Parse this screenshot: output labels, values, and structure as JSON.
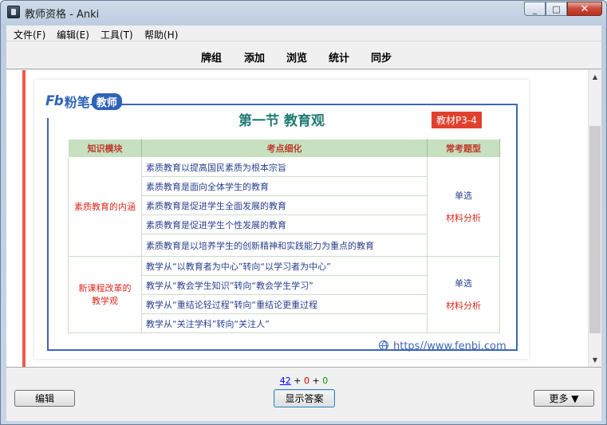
{
  "window": {
    "title": "教师资格 - Anki",
    "controls": {
      "minimize": "▭",
      "maximize": "□",
      "close": "✕"
    }
  },
  "menu": [
    "文件(F)",
    "编辑(E)",
    "工具(T)",
    "帮助(H)"
  ],
  "toolbar": {
    "decks": "牌组",
    "add": "添加",
    "browse": "浏览",
    "stats": "统计",
    "sync": "同步"
  },
  "card": {
    "logo": {
      "fb": "Fb",
      "brand": "粉笔",
      "badge": "教师"
    },
    "section_title": "第一节 教育观",
    "book_ref": "教材P3-4",
    "table": {
      "headers": [
        "知识模块",
        "考点细化",
        "常考题型"
      ],
      "groups": [
        {
          "module": "素质教育的内涵",
          "points": [
            "素质教育以提高国民素质为根本宗旨",
            "素质教育是面向全体学生的教育",
            "素质教育是促进学生全面发展的教育",
            "素质教育是促进学生个性发展的教育",
            "素质教育是以培养学生的创新精神和实践能力为重点的教育"
          ],
          "qtypes": [
            "单选",
            "材料分析"
          ]
        },
        {
          "module_line1": "新课程改革的",
          "module_line2": "教学观",
          "points": [
            "教学从“以教育者为中心”转向“以学习者为中心”",
            "教学从“教会学生知识”转向“教会学生学习”",
            "教学从“重结论轻过程”转向“重结论更重过程",
            "教学从“关注学科”转向“关注人”"
          ],
          "qtypes": [
            "单选",
            "材料分析"
          ]
        }
      ]
    },
    "footer_url": "https//www.fenbi.com"
  },
  "counts": {
    "new": "42",
    "sep1": " + ",
    "learning": "0",
    "sep2": " + ",
    "review": "0"
  },
  "buttons": {
    "edit": "编辑",
    "show_answer": "显示答案",
    "more": "更多 ▼"
  },
  "scrollbar": {
    "up": "▲",
    "down": "▼"
  },
  "colors": {
    "accent_red": "#f15a4a",
    "brand_blue": "#2f62b8",
    "title_teal": "#1f7b73",
    "header_green": "#c6e0c0"
  }
}
